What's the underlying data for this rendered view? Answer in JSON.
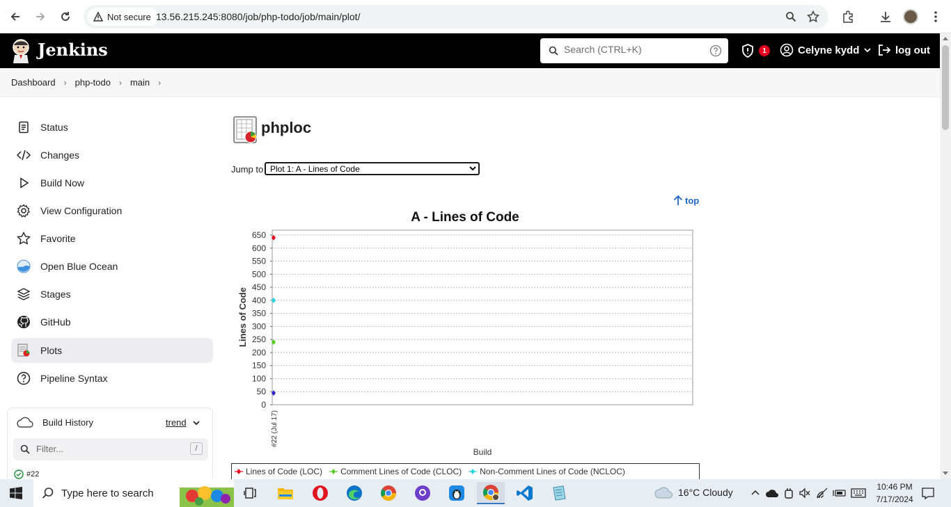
{
  "browser": {
    "security_label": "Not secure",
    "url": "13.56.215.245:8080/job/php-todo/job/main/plot/"
  },
  "header": {
    "brand": "Jenkins",
    "search_placeholder": "Search (CTRL+K)",
    "alert_count": "1",
    "user_name": "Celyne kydd",
    "logout_label": "log out"
  },
  "breadcrumb": [
    "Dashboard",
    "php-todo",
    "main"
  ],
  "sidebar": {
    "items": [
      {
        "label": "Status",
        "icon": "status-icon"
      },
      {
        "label": "Changes",
        "icon": "code-icon"
      },
      {
        "label": "Build Now",
        "icon": "play-icon"
      },
      {
        "label": "View Configuration",
        "icon": "gear-icon"
      },
      {
        "label": "Favorite",
        "icon": "star-icon"
      },
      {
        "label": "Open Blue Ocean",
        "icon": "blue-ocean-icon"
      },
      {
        "label": "Stages",
        "icon": "layers-icon"
      },
      {
        "label": "GitHub",
        "icon": "github-icon"
      },
      {
        "label": "Plots",
        "icon": "plot-icon"
      },
      {
        "label": "Pipeline Syntax",
        "icon": "help-icon"
      }
    ],
    "build_history": {
      "title": "Build History",
      "trend_label": "trend",
      "filter_placeholder": "Filter...",
      "filter_shortcut": "/",
      "builds": [
        "#22"
      ]
    }
  },
  "main": {
    "title": "phploc",
    "jump_label": "Jump to",
    "jump_selected": "Plot 1: A - Lines of Code",
    "top_link": "top"
  },
  "chart_data": {
    "type": "line",
    "title": "A - Lines of Code",
    "xlabel": "Build",
    "ylabel": "Lines of Code",
    "categories": [
      "#22 (Jul 17)"
    ],
    "ylim": [
      0,
      650
    ],
    "yticks": [
      0,
      50,
      100,
      150,
      200,
      250,
      300,
      350,
      400,
      450,
      500,
      550,
      600,
      650
    ],
    "grid": true,
    "legend_position": "bottom",
    "series": [
      {
        "name": "Lines of Code (LOC)",
        "values": [
          640
        ],
        "color": "#e8001c"
      },
      {
        "name": "Comment Lines of Code (CLOC)",
        "values": [
          240
        ],
        "color": "#55cc22"
      },
      {
        "name": "Non-Comment Lines of Code (NCLOC)",
        "values": [
          400
        ],
        "color": "#22d4e0"
      },
      {
        "name": "",
        "values": [
          45
        ],
        "color": "#3322cc"
      }
    ]
  },
  "taskbar": {
    "search_placeholder": "Type here to search",
    "weather": "16°C  Cloudy",
    "time": "10:46 PM",
    "date": "7/17/2024"
  }
}
